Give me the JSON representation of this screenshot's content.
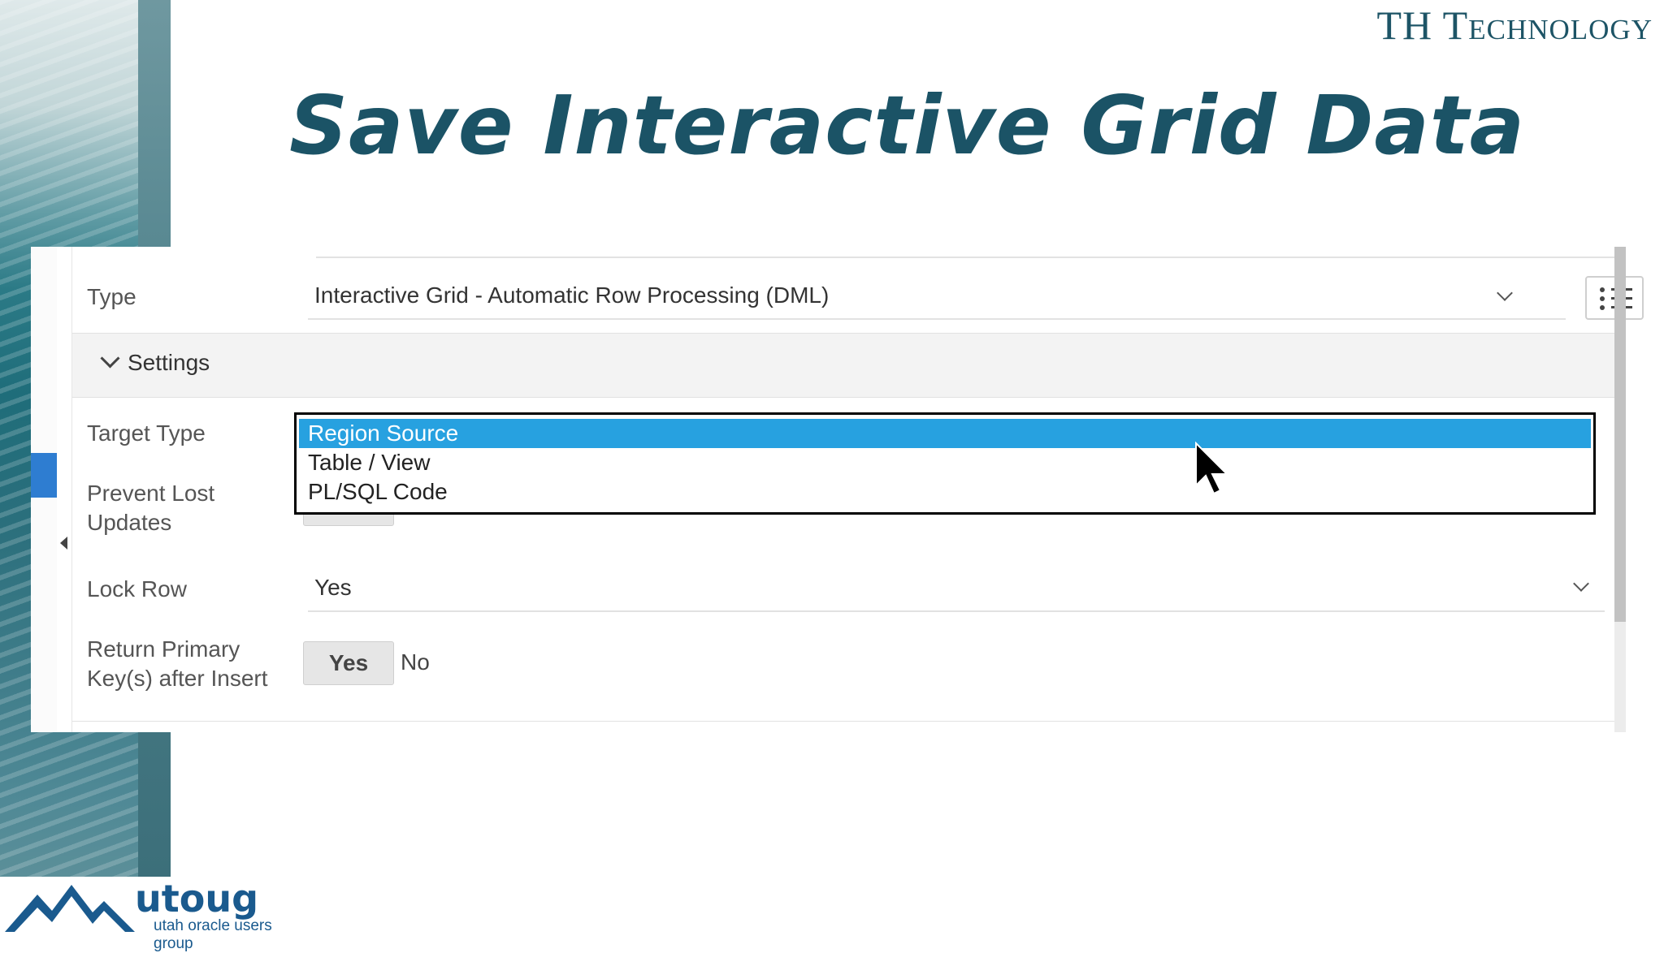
{
  "slide": {
    "brand": "TH Technology",
    "title": "Save Interactive Grid Data",
    "logo": {
      "name": "utoug",
      "subtitle": "utah oracle users group"
    }
  },
  "form": {
    "type_label": "Type",
    "type_value": "Interactive Grid - Automatic Row Processing (DML)",
    "settings_label": "Settings",
    "target_type_label": "Target Type",
    "prevent_lost_label_1": "Prevent Lost",
    "prevent_lost_label_2": "Updates",
    "lock_row_label": "Lock Row",
    "lock_row_value": "Yes",
    "return_pk_label_1": "Return Primary",
    "return_pk_label_2": "Key(s) after Insert",
    "yes_label": "Yes",
    "no_label": "No"
  },
  "dropdown": {
    "options": [
      "Region Source",
      "Table / View",
      "PL/SQL Code"
    ],
    "selected_index": 0
  },
  "icons": [
    "list-view-icon",
    "chevron-down-icon",
    "mouse-cursor-icon"
  ],
  "colors": {
    "title": "#1b5366",
    "selected": "#27a1e0",
    "brand": "#1d5466"
  }
}
